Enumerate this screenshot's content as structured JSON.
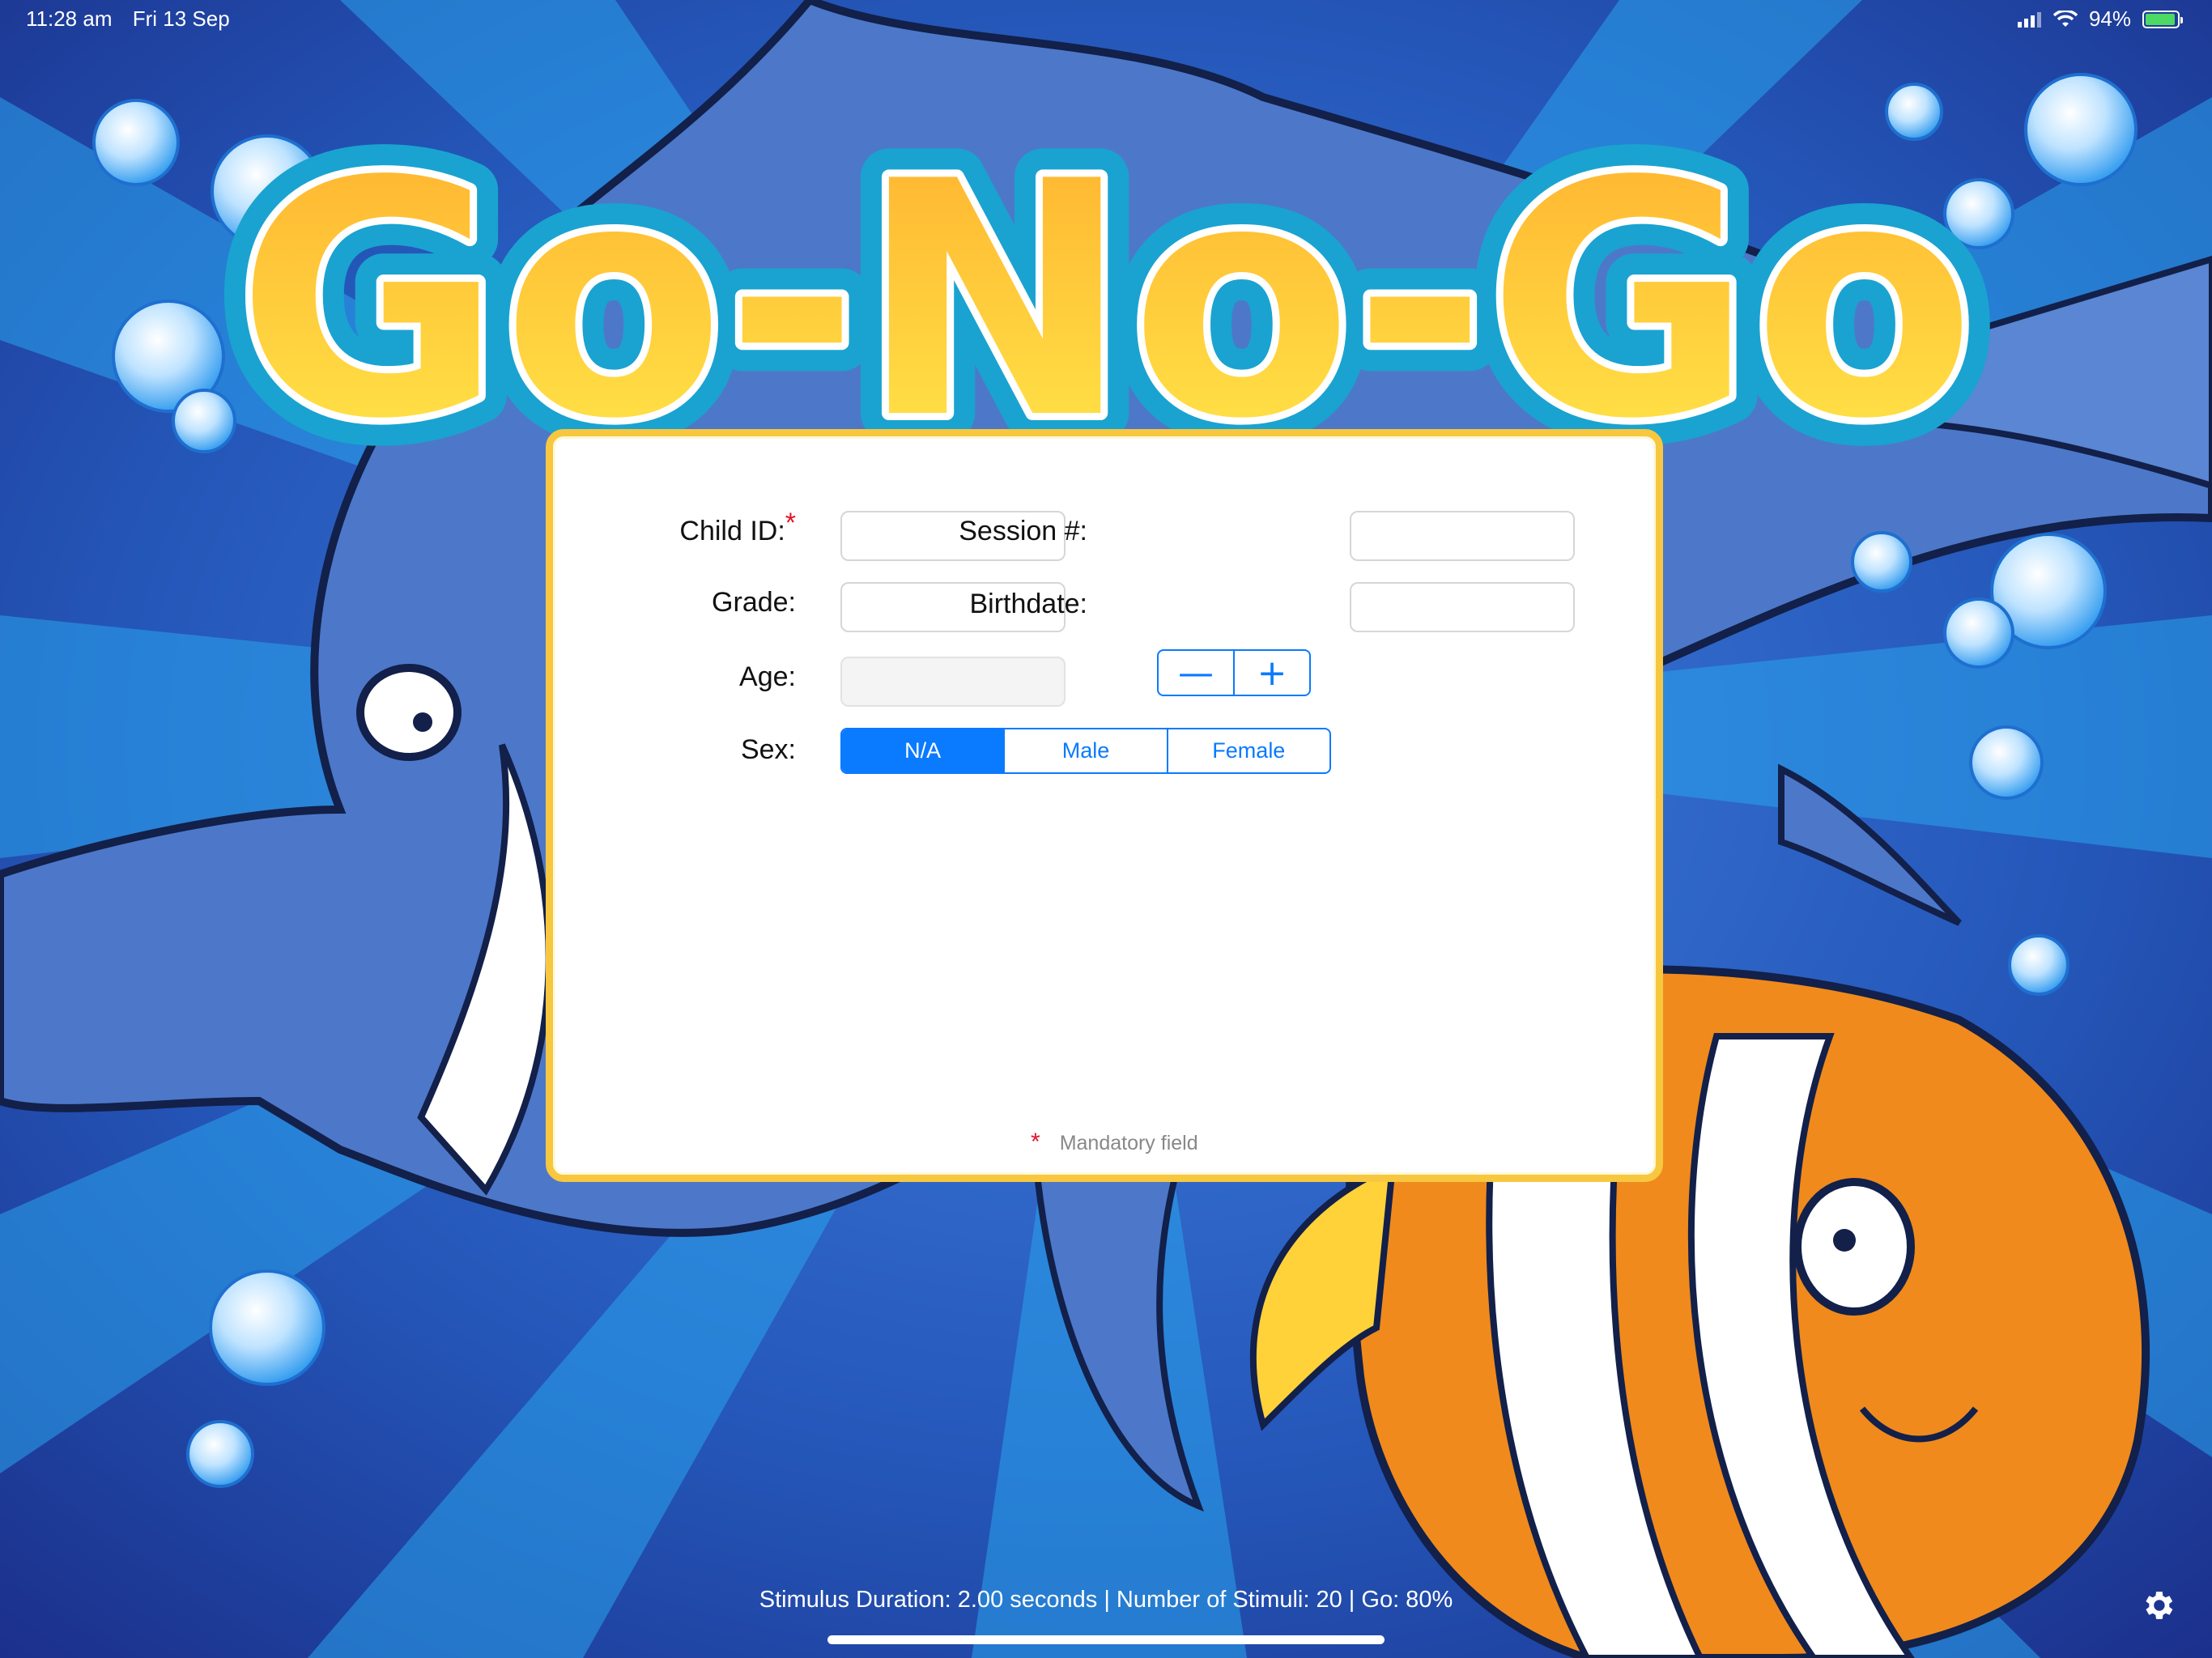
{
  "status_bar": {
    "time": "11:28 am",
    "date": "Fri 13 Sep",
    "battery": "94%",
    "battery_level": 0.94
  },
  "logo": {
    "text": "Go-No-Go"
  },
  "form": {
    "child_id": {
      "label": "Child ID:",
      "required_mark": "*",
      "value": ""
    },
    "session": {
      "label": "Session #:",
      "value": ""
    },
    "grade": {
      "label": "Grade:",
      "value": ""
    },
    "birthdate": {
      "label": "Birthdate:",
      "value": ""
    },
    "age": {
      "label": "Age:",
      "value": "",
      "decrement": "—",
      "increment": "+"
    },
    "sex": {
      "label": "Sex:",
      "options": [
        "N/A",
        "Male",
        "Female"
      ],
      "selected": "N/A"
    },
    "mandatory_note": {
      "mark": "*",
      "text": "Mandatory field"
    }
  },
  "footer": {
    "settings_summary": "Stimulus Duration: 2.00 seconds | Number of Stimuli: 20 | Go: 80%",
    "settings_icon": "gear-icon"
  },
  "colors": {
    "accent": "#0a7aff",
    "card_border": "#f7c740",
    "required": "#e0142a",
    "ocean": "#1d4fa8"
  }
}
